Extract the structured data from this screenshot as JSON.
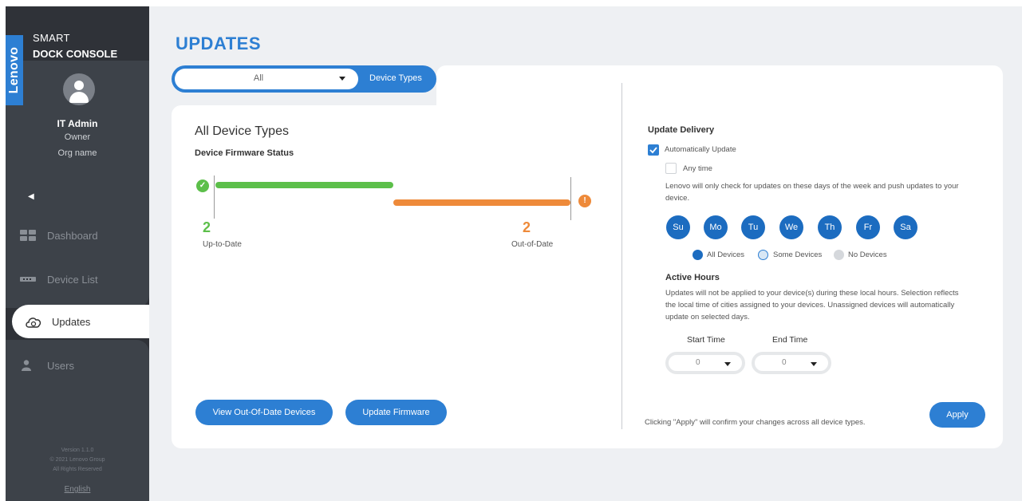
{
  "brand": {
    "logo_text": "Lenovo",
    "line1": "SMART",
    "line2": "DOCK CONSOLE"
  },
  "user": {
    "name": "IT Admin",
    "role": "Owner",
    "org": "Org name"
  },
  "nav": {
    "items": [
      {
        "label": "Dashboard",
        "icon": "dashboard-icon"
      },
      {
        "label": "Device List",
        "icon": "device-list-icon"
      },
      {
        "label": "Updates",
        "icon": "cloud-update-icon",
        "active": true
      },
      {
        "label": "Users",
        "icon": "user-icon"
      }
    ]
  },
  "footer": {
    "version": "Version 1.1.0",
    "copyright": "© 2021 Lenovo Group",
    "rights": "All Rights Reserved",
    "language": "English"
  },
  "page": {
    "title": "UPDATES"
  },
  "filter": {
    "selected": "All",
    "label": "Device Types"
  },
  "firmware": {
    "title": "All Device Types",
    "subtitle": "Device Firmware Status",
    "up_to_date_count": "2",
    "up_to_date_label": "Up-to-Date",
    "out_of_date_count": "2",
    "out_of_date_label": "Out-of-Date",
    "up_color": "#5cbf4a",
    "out_color": "#ee8a3a"
  },
  "buttons": {
    "view_out_of_date": "View Out-Of-Date Devices",
    "update_firmware": "Update Firmware",
    "apply": "Apply"
  },
  "delivery": {
    "title": "Update Delivery",
    "auto_update_label": "Automatically Update",
    "auto_update_checked": true,
    "any_time_label": "Any time",
    "any_time_checked": false,
    "days_note": "Lenovo will only check for updates on these days of the week and push updates to your device.",
    "days": [
      "Su",
      "Mo",
      "Tu",
      "We",
      "Th",
      "Fr",
      "Sa"
    ],
    "legend": [
      "All Devices",
      "Some Devices",
      "No Devices"
    ]
  },
  "active_hours": {
    "title": "Active Hours",
    "note": "Updates will not be applied to your device(s) during these local hours. Selection reflects the local time of cities assigned to your devices. Unassigned devices will automatically update on selected days.",
    "start_label": "Start Time",
    "start_value": "0",
    "end_label": "End Time",
    "end_value": "0"
  },
  "apply_note": "Clicking \"Apply\" will confirm your changes across all device types.",
  "colors": {
    "accent": "#2d7fd3",
    "day_blue": "#1c6cc0",
    "sidebar": "#2f3238"
  }
}
